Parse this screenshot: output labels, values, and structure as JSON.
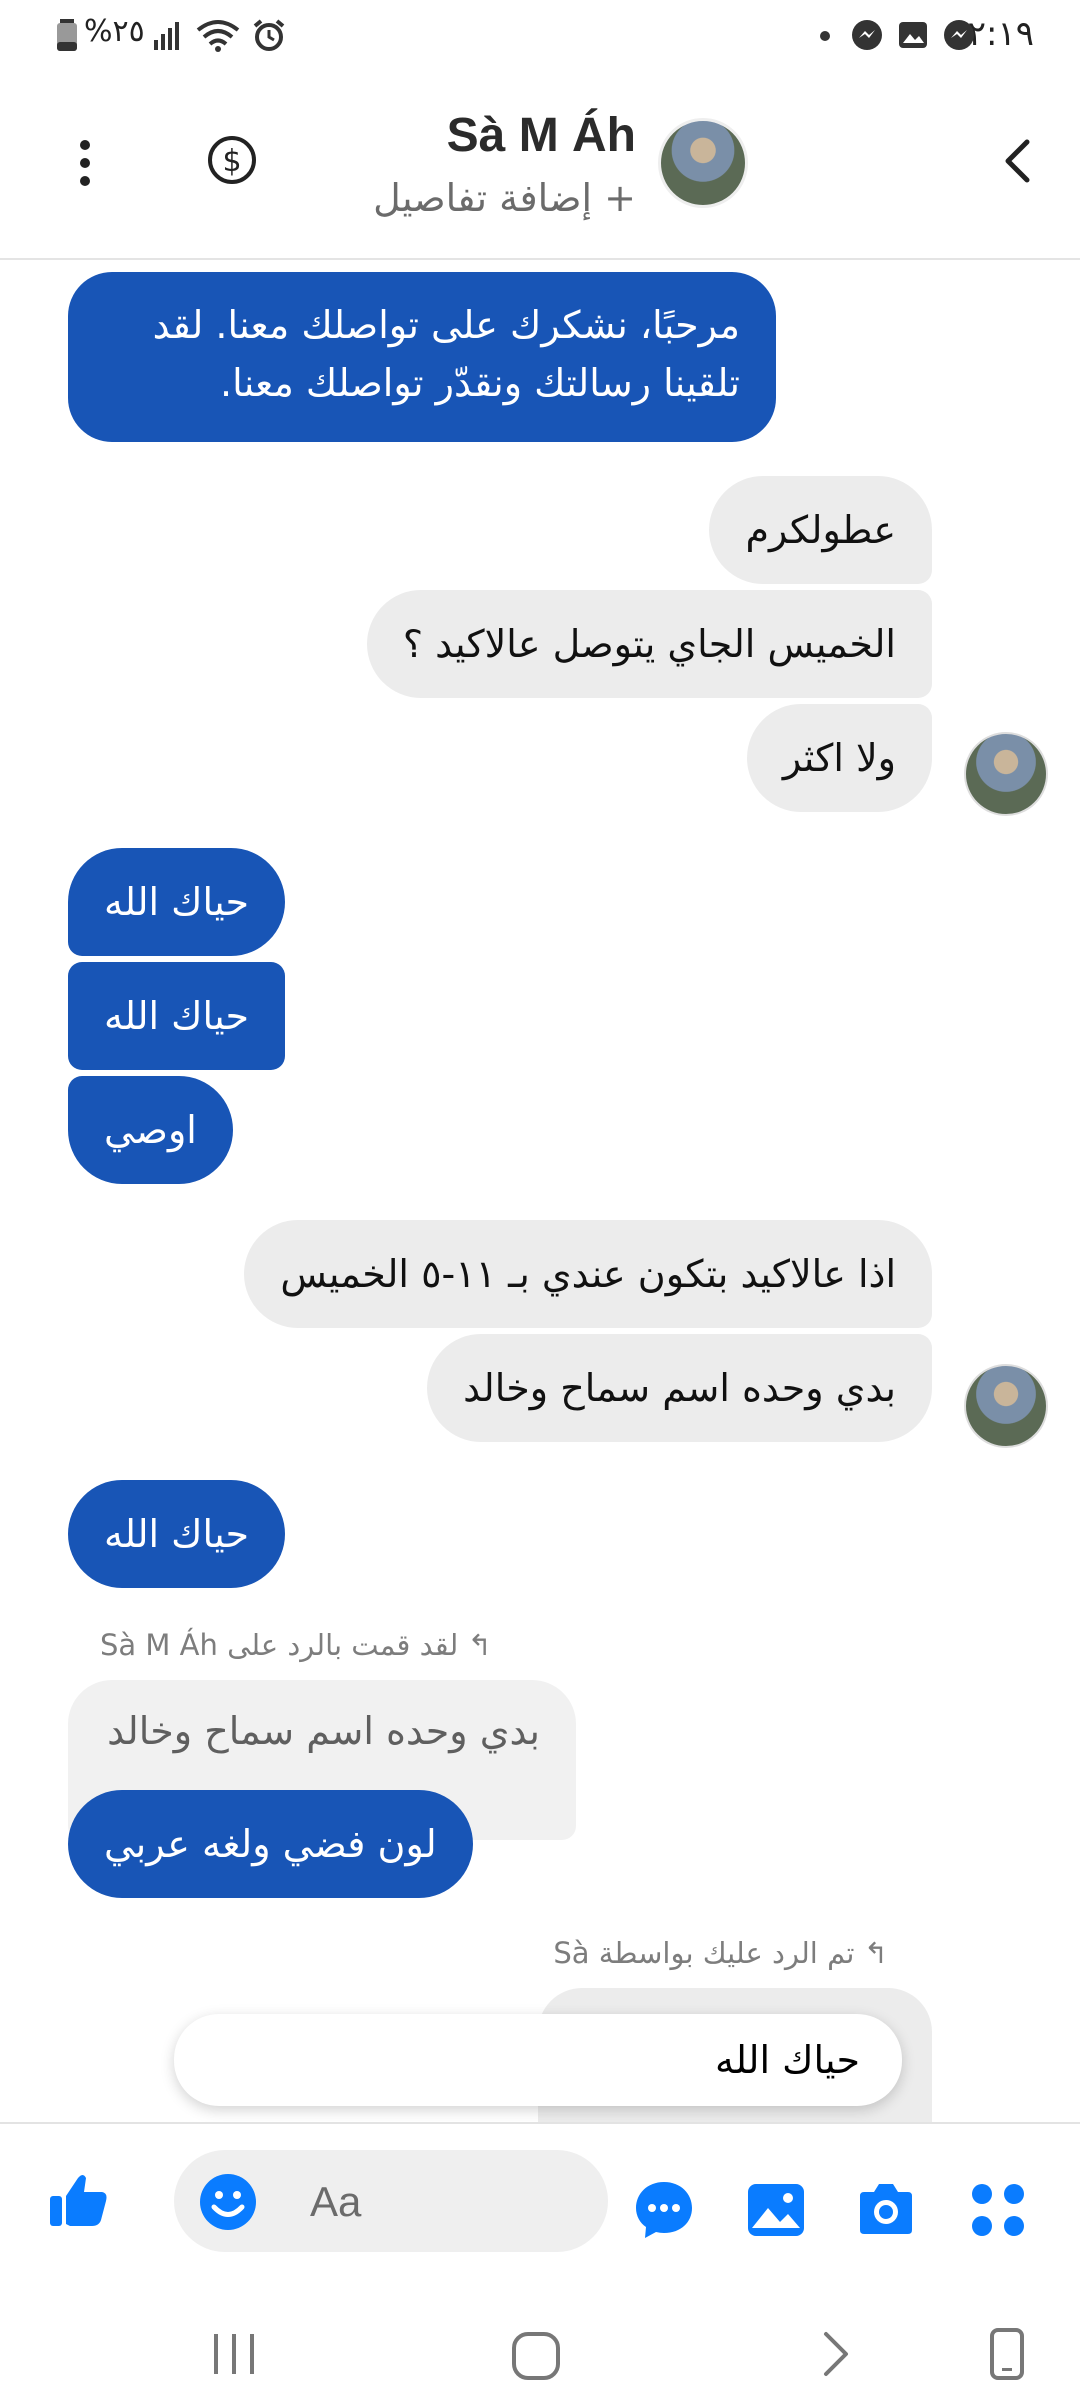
{
  "status_bar": {
    "time": "١٢:١٩",
    "battery": "%٢٥"
  },
  "header": {
    "contact_name": "Sà M Áh",
    "subtitle": "+ إضافة تفاصيل"
  },
  "messages": [
    {
      "from": "me",
      "text_line1": "مرحبًا، نشكرك على تواصلك معنا. لقد",
      "text_line2": "تلقينا رسالتك ونقدّر تواصلك معنا."
    },
    {
      "from": "them",
      "text": "عطولكرم"
    },
    {
      "from": "them",
      "text": "الخميس الجاي يتوصل عالاكيد ؟"
    },
    {
      "from": "them",
      "text": "ولا اكثر"
    },
    {
      "from": "me",
      "text": "حياك الله"
    },
    {
      "from": "me",
      "text": "حياك الله"
    },
    {
      "from": "me",
      "text": "اوصي"
    },
    {
      "from": "them",
      "text": "اذا عالاكيد بتكون عندي بـ ١١-٥ الخميس"
    },
    {
      "from": "them",
      "text": "بدي وحده اسم سماح وخالد"
    },
    {
      "from": "me",
      "text": "حياك الله"
    },
    {
      "from": "me",
      "reply_note": "لقد قمت بالرد على Sà M Áh",
      "quoted": "بدي وحده اسم سماح وخالد",
      "text": "لون فضي ولغه عربي"
    },
    {
      "from": "them",
      "reply_note": "تم الرد عليك بواسطة Sà"
    }
  ],
  "floating_preview": "حياك الله",
  "composer": {
    "placeholder": "Aa"
  },
  "colors": {
    "accent": "#1855b6",
    "incoming_bubble": "#ececec",
    "icon_blue": "#0a7cff"
  }
}
